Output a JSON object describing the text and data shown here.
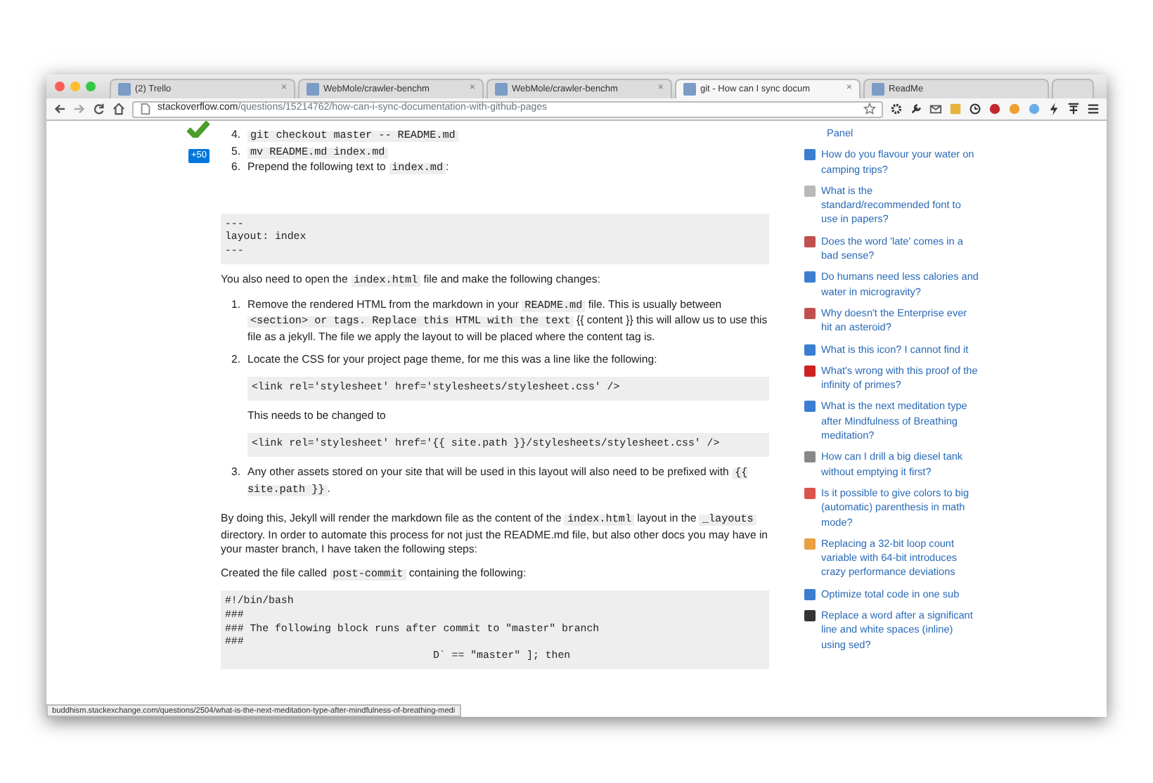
{
  "window": {
    "tabs": [
      {
        "label": "(2) Trello",
        "selected": false,
        "close_glyph": "×"
      },
      {
        "label": "WebMole/crawler-benchm",
        "selected": false,
        "close_glyph": "×"
      },
      {
        "label": "WebMole/crawler-benchm",
        "selected": false,
        "close_glyph": "×"
      },
      {
        "label": "git - How can I sync docum",
        "selected": true,
        "close_glyph": "×"
      },
      {
        "label": "ReadMe",
        "selected": false
      }
    ],
    "url_host": "stackoverflow.com",
    "url_path": "/questions/15214762/how-can-i-sync-documentation-with-github-pages",
    "bookmarked": false
  },
  "answer": {
    "accepted": true,
    "bounty": "+50",
    "steps_top": [
      {
        "number": "4.",
        "parts": [
          {
            "text": "git checkout master -- README.md",
            "kind": "code"
          }
        ]
      },
      {
        "number": "5.",
        "parts": [
          {
            "text": "mv README.md index.md",
            "kind": "code"
          }
        ]
      },
      {
        "number": "6.",
        "parts": [
          {
            "text": "Prepend the following text to ",
            "kind": "text"
          },
          {
            "text": "index.md",
            "kind": "code"
          },
          {
            "text": ":",
            "kind": "text"
          }
        ]
      }
    ],
    "blocks": [
      {
        "kind": "pre",
        "lines": [
          "---",
          "layout: index",
          "---"
        ]
      },
      {
        "kind": "para",
        "parts": [
          {
            "text": "You also need to open the ",
            "kind": "text"
          },
          {
            "text": "index.html",
            "kind": "code"
          },
          {
            "text": " file and make the following changes:",
            "kind": "text"
          }
        ]
      },
      {
        "kind": "steps",
        "items": [
          {
            "number": "1.",
            "body": [
              {
                "kind": "para",
                "parts": [
                  {
                    "text": "Remove the rendered HTML from the markdown in your ",
                    "kind": "text"
                  },
                  {
                    "text": "README.md",
                    "kind": "code"
                  },
                  {
                    "text": " file. This is usually between ",
                    "kind": "text"
                  },
                  {
                    "text": "<section> or tags. Replace this HTML with the text",
                    "kind": "code"
                  },
                  {
                    "text": " {{ content }} this will allow us to use this file as a jekyll. The file we apply the layout to will be placed where the content tag is.",
                    "kind": "text"
                  }
                ]
              }
            ]
          },
          {
            "number": "2.",
            "body": [
              {
                "kind": "para",
                "parts": [
                  {
                    "text": "Locate the CSS for your project page theme, for me this was a line like the following:",
                    "kind": "text"
                  }
                ]
              },
              {
                "kind": "pre",
                "lines": [
                  "<link rel='stylesheet' href='stylesheets/stylesheet.css' />"
                ]
              },
              {
                "kind": "para",
                "parts": [
                  {
                    "text": "This needs to be changed to",
                    "kind": "text"
                  }
                ]
              },
              {
                "kind": "pre",
                "lines": [
                  "<link rel='stylesheet' href='{{ site.path }}/stylesheets/stylesheet.css' />"
                ]
              }
            ]
          },
          {
            "number": "3.",
            "body": [
              {
                "kind": "para",
                "parts": [
                  {
                    "text": "Any other assets stored on your site that will be used in this layout will also need to be prefixed with ",
                    "kind": "text"
                  },
                  {
                    "text": "{{ site.path }}",
                    "kind": "code"
                  },
                  {
                    "text": ".",
                    "kind": "text"
                  }
                ]
              }
            ]
          }
        ]
      },
      {
        "kind": "para",
        "parts": [
          {
            "text": "By doing this, Jekyll will render the markdown file as the content of the ",
            "kind": "text"
          },
          {
            "text": "index.html",
            "kind": "code"
          },
          {
            "text": " layout in the ",
            "kind": "text"
          },
          {
            "text": "_layouts",
            "kind": "code"
          },
          {
            "text": " directory. In order to automate this process for not just the README.md file, but also other docs you may have in your master branch, I have taken the following steps:",
            "kind": "text"
          }
        ]
      },
      {
        "kind": "para",
        "parts": [
          {
            "text": "Created the file called ",
            "kind": "text"
          },
          {
            "text": "post-commit",
            "kind": "code"
          },
          {
            "text": " containing the following:",
            "kind": "text"
          }
        ]
      },
      {
        "kind": "pre",
        "lines": [
          "#!/bin/bash",
          "###",
          "### The following block runs after commit to \"master\" branch",
          "###",
          "D` == \"master\" ]; then"
        ]
      }
    ]
  },
  "sidebar": {
    "continued_text": "Panel",
    "items": [
      {
        "text": "How do you flavour your water on camping trips?",
        "color": "#3b7ed1"
      },
      {
        "text": "What is the standard/recommended font to use in papers?",
        "color": "#b8b8b8"
      },
      {
        "text": "Does the word 'late' comes in a bad sense?",
        "color": "#c0504d"
      },
      {
        "text": "Do humans need less calories and water in microgravity?",
        "color": "#3b7ed1"
      },
      {
        "text": "Why doesn't the Enterprise ever hit an asteroid?",
        "color": "#c0504d"
      },
      {
        "text": "What is this icon? I cannot find it",
        "color": "#3b7ed1"
      },
      {
        "text": "What's wrong with this proof of the infinity of primes?",
        "color": "#cc2222"
      },
      {
        "text": "What is the next meditation type after Mindfulness of Breathing meditation?",
        "color": "#3b7ed1"
      },
      {
        "text": "How can I drill a big diesel tank without emptying it first?",
        "color": "#888888"
      },
      {
        "text": "Is it possible to give colors to big (automatic) parenthesis in math mode?",
        "color": "#d9534f"
      },
      {
        "text": "Replacing a 32-bit loop count variable with 64-bit introduces crazy performance deviations",
        "color": "#e8a040"
      },
      {
        "text": "Optimize total code in one sub",
        "color": "#3b7ed1"
      },
      {
        "text": "Replace a word after a significant line and white spaces (inline) using sed?",
        "color": "#333333"
      }
    ]
  },
  "status_bar": "buddhism.stackexchange.com/questions/2504/what-is-the-next-meditation-type-after-mindfulness-of-breathing-medi"
}
